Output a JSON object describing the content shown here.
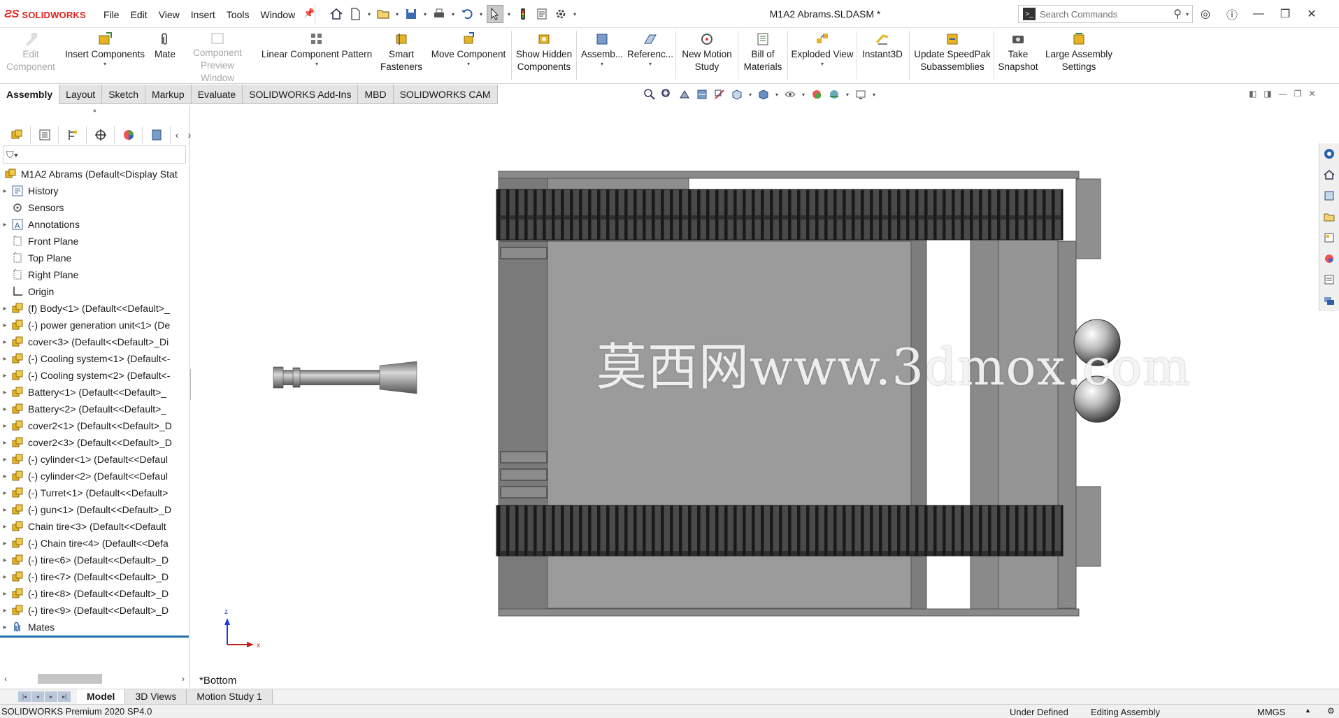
{
  "app": {
    "brand": "SOLIDWORKS",
    "document_title": "M1A2 Abrams.SLDASM *"
  },
  "menu": [
    "File",
    "Edit",
    "View",
    "Insert",
    "Tools",
    "Window"
  ],
  "search": {
    "placeholder": "Search Commands"
  },
  "commands": {
    "edit_component": [
      "Edit",
      "Component"
    ],
    "insert_components": "Insert Components",
    "mate": "Mate",
    "component_preview": [
      "Component",
      "Preview Window"
    ],
    "linear_pattern": "Linear Component Pattern",
    "smart_fasteners": [
      "Smart",
      "Fasteners"
    ],
    "move_component": "Move Component",
    "show_hidden": [
      "Show Hidden",
      "Components"
    ],
    "assembly": "Assemb...",
    "reference": "Referenc...",
    "new_motion": [
      "New Motion",
      "Study"
    ],
    "bom": [
      "Bill of",
      "Materials"
    ],
    "exploded": "Exploded View",
    "instant3d": "Instant3D",
    "speedpak": [
      "Update SpeedPak",
      "Subassemblies"
    ],
    "snapshot": [
      "Take",
      "Snapshot"
    ],
    "large_assembly": [
      "Large Assembly",
      "Settings"
    ]
  },
  "tabs": [
    "Assembly",
    "Layout",
    "Sketch",
    "Markup",
    "Evaluate",
    "SOLIDWORKS Add-Ins",
    "MBD",
    "SOLIDWORKS CAM"
  ],
  "active_tab": "Assembly",
  "tree": {
    "root": "M1A2 Abrams  (Default<Display Stat",
    "items": [
      {
        "label": "History",
        "icon": "history-icon",
        "exp": true
      },
      {
        "label": "Sensors",
        "icon": "sensors-icon",
        "exp": false
      },
      {
        "label": "Annotations",
        "icon": "annotations-icon",
        "exp": true
      },
      {
        "label": "Front Plane",
        "icon": "plane-icon",
        "exp": false
      },
      {
        "label": "Top Plane",
        "icon": "plane-icon",
        "exp": false
      },
      {
        "label": "Right Plane",
        "icon": "plane-icon",
        "exp": false
      },
      {
        "label": "Origin",
        "icon": "origin-icon",
        "exp": false
      },
      {
        "label": "(f) Body<1> (Default<<Default>_",
        "icon": "component-icon",
        "exp": true
      },
      {
        "label": "(-) power generation unit<1> (De",
        "icon": "component-icon",
        "exp": true
      },
      {
        "label": "cover<3> (Default<<Default>_Di",
        "icon": "component-icon",
        "exp": true
      },
      {
        "label": "(-) Cooling system<1> (Default<-",
        "icon": "component-icon",
        "exp": true
      },
      {
        "label": "(-) Cooling system<2> (Default<-",
        "icon": "component-icon",
        "exp": true
      },
      {
        "label": "Battery<1> (Default<<Default>_",
        "icon": "component-icon",
        "exp": true
      },
      {
        "label": "Battery<2> (Default<<Default>_",
        "icon": "component-icon",
        "exp": true
      },
      {
        "label": "cover2<1> (Default<<Default>_D",
        "icon": "component-icon",
        "exp": true
      },
      {
        "label": "cover2<3> (Default<<Default>_D",
        "icon": "component-icon",
        "exp": true
      },
      {
        "label": "(-) cylinder<1> (Default<<Defaul",
        "icon": "component-icon",
        "exp": true
      },
      {
        "label": "(-) cylinder<2> (Default<<Defaul",
        "icon": "component-icon",
        "exp": true
      },
      {
        "label": "(-) Turret<1> (Default<<Default>",
        "icon": "component-icon",
        "exp": true
      },
      {
        "label": "(-) gun<1> (Default<<Default>_D",
        "icon": "component-icon",
        "exp": true
      },
      {
        "label": "Chain tire<3> (Default<<Default",
        "icon": "component-icon",
        "exp": true
      },
      {
        "label": "(-) Chain tire<4> (Default<<Defa",
        "icon": "component-icon",
        "exp": true
      },
      {
        "label": "(-) tire<6> (Default<<Default>_D",
        "icon": "component-icon",
        "exp": true
      },
      {
        "label": "(-) tire<7> (Default<<Default>_D",
        "icon": "component-icon",
        "exp": true
      },
      {
        "label": "(-) tire<8> (Default<<Default>_D",
        "icon": "component-icon",
        "exp": true
      },
      {
        "label": "(-) tire<9> (Default<<Default>_D",
        "icon": "component-icon",
        "exp": true
      },
      {
        "label": "Mates",
        "icon": "mates-icon",
        "exp": true
      }
    ]
  },
  "viewport": {
    "view_name": "*Bottom",
    "watermark": "莫西网www.3dmox.com",
    "triad": {
      "z": "z",
      "x": "x"
    }
  },
  "bottom_tabs": [
    "Model",
    "3D Views",
    "Motion Study 1"
  ],
  "active_bottom_tab": "Model",
  "status": {
    "product": "SOLIDWORKS Premium 2020 SP4.0",
    "definition": "Under Defined",
    "mode": "Editing Assembly",
    "units": "MMGS"
  },
  "colors": {
    "accent": "#1f6fb2",
    "brand_red": "#e2231a",
    "component_yellow": "#e6b422",
    "model_gray": "#9a9a9a"
  }
}
